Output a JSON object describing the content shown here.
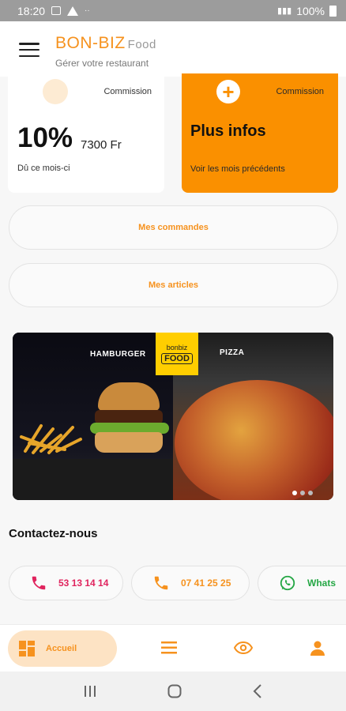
{
  "status_bar": {
    "time": "18:20",
    "battery": "100%"
  },
  "header": {
    "brand": "BON-BIZ",
    "brand_suffix": "Food",
    "subtitle": "Gérer votre restaurant"
  },
  "commission_card": {
    "label": "Commission",
    "percentage": "10%",
    "amount": "7300 Fr",
    "period": "Dû ce mois-ci"
  },
  "info_card": {
    "label": "Commission",
    "title": "Plus infos",
    "subtitle": "Voir les mois précédents"
  },
  "actions": {
    "orders_label": "Mes commandes",
    "articles_label": "Mes articles"
  },
  "banner": {
    "left_label": "HAMBURGER",
    "right_label": "PIZZA",
    "logo_top": "bonbiz",
    "logo_bottom": "FOOD",
    "slide_count": 3,
    "active_slide": 1
  },
  "contact": {
    "title": "Contactez-nous",
    "items": [
      {
        "label": "53 13 14 14",
        "icon": "phone-icon",
        "color": "#e0245e"
      },
      {
        "label": "07 41 25 25",
        "icon": "phone-icon",
        "color": "#f6921e"
      },
      {
        "label": "Whats",
        "icon": "whatsapp-icon",
        "color": "#25a745"
      }
    ]
  },
  "bottom_nav": {
    "home_label": "Accueil",
    "items": [
      "dashboard-icon",
      "menu-icon",
      "eye-icon",
      "user-icon"
    ]
  },
  "colors": {
    "accent": "#f6921e",
    "orange_card": "#fa9000",
    "pill_bg": "#fde3c4"
  }
}
